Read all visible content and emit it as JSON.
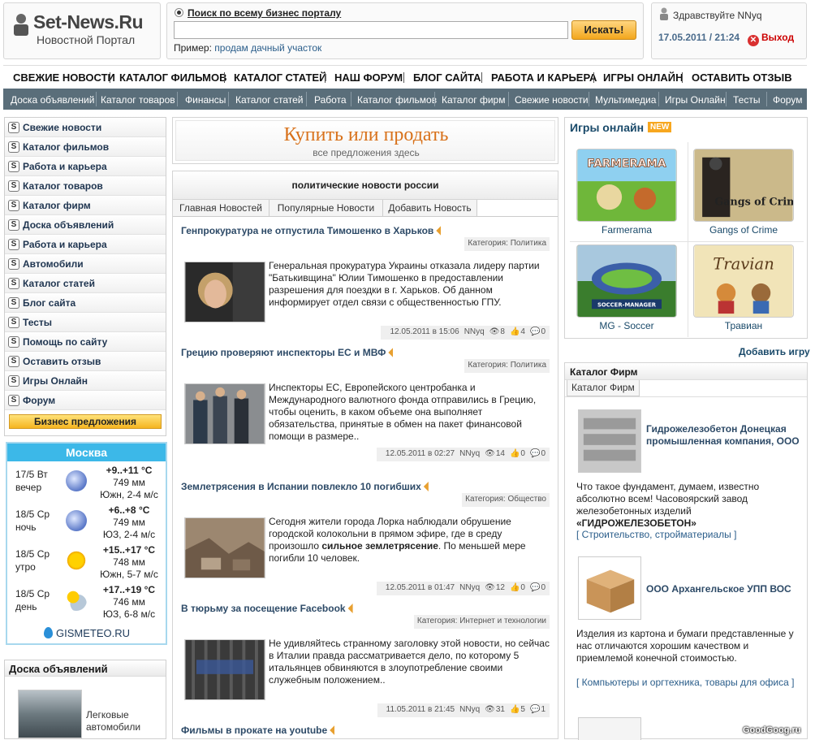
{
  "logo": {
    "title": "Set-News.Ru",
    "subtitle": "Новостной Портал"
  },
  "search": {
    "radio_label": "Поиск по всему бизнес порталу",
    "button_label": "Искать!",
    "input_value": "",
    "example_label": "Пример:",
    "example_value": "продам дачный участок"
  },
  "user": {
    "greeting": "Здравствуйте NNyq",
    "datetime": "17.05.2011 / 21:24",
    "logout_label": "Выход"
  },
  "nav_main": [
    "СВЕЖИЕ НОВОСТИ",
    "КАТАЛОГ ФИЛЬМОВ",
    "КАТАЛОГ СТАТЕЙ",
    "НАШ ФОРУМ",
    "БЛОГ САЙТА",
    "РАБОТА И КАРЬЕРА",
    "ИГРЫ ОНЛАЙН",
    "ОСТАВИТЬ ОТЗЫВ"
  ],
  "nav_sub": [
    "Доска объявлений",
    "Каталог товаров",
    "Финансы",
    "Каталог статей",
    "Работа",
    "Каталог фильмов",
    "Каталог фирм",
    "Свежие новости",
    "Мультимедиа",
    "Игры Онлайн",
    "Тесты",
    "Форум"
  ],
  "left_menu": [
    "Свежие новости",
    "Каталог фильмов",
    "Работа и карьера",
    "Каталог товаров",
    "Каталог фирм",
    "Доска объявлений",
    "Работа и карьера",
    "Автомобили",
    "Каталог статей",
    "Блог сайта",
    "Тесты",
    "Помощь по сайту",
    "Оставить отзыв",
    "Игры Онлайн",
    "Форум"
  ],
  "biz_button": "Бизнес предложения",
  "weather": {
    "city": "Москва",
    "rows": [
      {
        "day": "17/5 Вт",
        "part": "вечер",
        "temp": "+9..+11 °C",
        "pressure": "749 мм",
        "wind": "Южн, 2-4 м/с",
        "icon": "moon-icon"
      },
      {
        "day": "18/5 Ср",
        "part": "ночь",
        "temp": "+6..+8 °C",
        "pressure": "749 мм",
        "wind": "ЮЗ, 2-4 м/с",
        "icon": "moon-icon"
      },
      {
        "day": "18/5 Ср",
        "part": "утро",
        "temp": "+15..+17 °C",
        "pressure": "748 мм",
        "wind": "Южн, 5-7 м/с",
        "icon": "sun-icon"
      },
      {
        "day": "18/5 Ср",
        "part": "день",
        "temp": "+17..+19 °C",
        "pressure": "746 мм",
        "wind": "ЮЗ, 6-8 м/с",
        "icon": "sun-rain-cloud-icon"
      }
    ],
    "source": "GISMETEO.RU"
  },
  "doska": {
    "title": "Доска объявлений",
    "item_label": "Легковые автомобили"
  },
  "banner": {
    "title": "Купить или продать",
    "subtitle": "все предложения здесь"
  },
  "news": {
    "header": "политические новости россии",
    "tabs": [
      "Главная Новостей",
      "Популярные Новости",
      "Добавить Новость"
    ],
    "items": [
      {
        "title": "Генпрокуратура не отпустила Тимошенко в Харьков",
        "category": "Категория: Политика",
        "text": "Генеральная прокуратура Украины отказала лидеру партии \"Батькивщина\" Юлии Тимошенко в предоставлении разрешения для поездки в г. Харьков. Об данном информирует отдел связи с общественностью ГПУ.",
        "date": "12.05.2011 в 15:06",
        "user": "NNyq",
        "views": "8",
        "likes": "4",
        "comments": "0"
      },
      {
        "title": "Грецию проверяют инспекторы ЕС и МВФ",
        "category": "Категория: Политика",
        "text": " Инспекторы ЕС, Европейского центробанка и Международного валютного фонда отправились в Грецию, чтобы оценить, в каком объеме она выполняет обязательства, принятые в обмен на пакет финансовой помощи в размере..",
        "date": "12.05.2011 в 02:27",
        "user": "NNyq",
        "views": "14",
        "likes": "0",
        "comments": "0"
      },
      {
        "title": "Землетрясения в Испании повлекло 10 погибших",
        "category": "Категория: Общество",
        "text_before": "Сегодня жители города Лорка наблюдали обрушение городской колокольни в прямом эфире, где в среду произошло ",
        "text_bold": "сильное землетрясение",
        "text_after": ". По меньшей мере погибли 10 человек.",
        "date": "12.05.2011 в 01:47",
        "user": "NNyq",
        "views": "12",
        "likes": "0",
        "comments": "0"
      },
      {
        "title": "В тюрьму за посещение Facebook",
        "category": "Категория: Интернет и технологии",
        "text": "Не удивляйтесь странному заголовку этой новости, но сейчас в Италии правда рассматривается дело, по которому 5 итальянцев обвиняются в злоупотребление своими служебным положением..",
        "date": "11.05.2011 в 21:45",
        "user": "NNyq",
        "views": "31",
        "likes": "5",
        "comments": "1"
      },
      {
        "title": "Фильмы в прокате на youtube"
      }
    ]
  },
  "games": {
    "title": "Игры онлайн",
    "badge": "NEW",
    "items": [
      {
        "name": "Farmerama",
        "art_text": "FARMERAMA"
      },
      {
        "name": "Gangs of Crime",
        "art_text": "Gangs of Crime"
      },
      {
        "name": "MG - Soccer",
        "art_text": "SOCCER-MANAGER"
      },
      {
        "name": "Травиан",
        "art_text": "Travian"
      }
    ],
    "add_link": "Добавить игру"
  },
  "firms": {
    "title": "Каталог Фирм",
    "tab": "Каталог Фирм",
    "items": [
      {
        "name": "Гидрожелезобетон Донецкая промышленная компания, ООО",
        "desc": "Что такое фундамент, думаем, известно абсолютно всем! Часовоярский завод железобетонных изделий ",
        "desc_bold": "«ГИДРОЖЕЛЕЗОБЕТОН»",
        "link": "[ Строительство, стройматериалы ]"
      },
      {
        "name": "ООО Архангельское УПП ВОС",
        "desc": "Изделия из картона и бумаги представленные у нас отличаются хорошим качеством и приемлемой конечной стоимостью.",
        "link": "[ Компьютеры и оргтехника, товары для офиса ]"
      }
    ]
  },
  "watermark": "GoodGoog.ru"
}
